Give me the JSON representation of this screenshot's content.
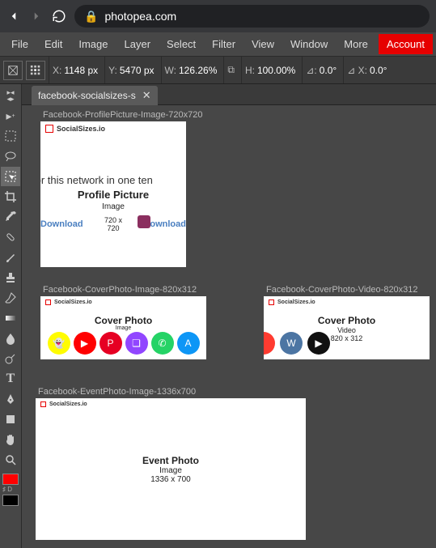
{
  "browser": {
    "url": "photopea.com"
  },
  "menu": {
    "file": "File",
    "edit": "Edit",
    "image": "Image",
    "layer": "Layer",
    "select": "Select",
    "filter": "Filter",
    "view": "View",
    "window": "Window",
    "more": "More",
    "account": "Account"
  },
  "options": {
    "x_label": "X:",
    "x_val": "1148 px",
    "y_label": "Y:",
    "y_val": "5470 px",
    "w_label": "W:",
    "w_val": "126.26%",
    "h_label": "H:",
    "h_val": "100.00%",
    "rot_label": "⊿:",
    "rot_val": "0.0°",
    "skew_label": "⊿ X:",
    "skew_val": "0.0°",
    "link_glyph": "⧉"
  },
  "tab": {
    "label": "facebook-socialsizes-s"
  },
  "colors": {
    "fg": "#ff0000",
    "bg": "#000000"
  },
  "swatch_label": "♯ D",
  "artboards": {
    "a1": {
      "label": "Facebook-ProfilePicture-Image-720x720",
      "ss_brand": "SocialSizes.io",
      "line1": "for this network in one ten",
      "title": "Profile Picture",
      "subtitle": "Image",
      "dims": "720 x 720",
      "dl": "Download"
    },
    "a2": {
      "label": "Facebook-CoverPhoto-Image-820x312",
      "ss_brand": "SocialSizes.io",
      "title": "Cover Photo",
      "subtitle": "Image"
    },
    "a3": {
      "label": "Facebook-CoverPhoto-Video-820x312",
      "ss_brand": "SocialSizes.io",
      "title": "Cover Photo",
      "subtitle": "Video",
      "dims": "820 x 312"
    },
    "a4": {
      "label": "Facebook-EventPhoto-Image-1336x700",
      "ss_brand": "SocialSizes.io",
      "title": "Event Photo",
      "subtitle": "Image",
      "dims": "1336 x 700"
    }
  }
}
